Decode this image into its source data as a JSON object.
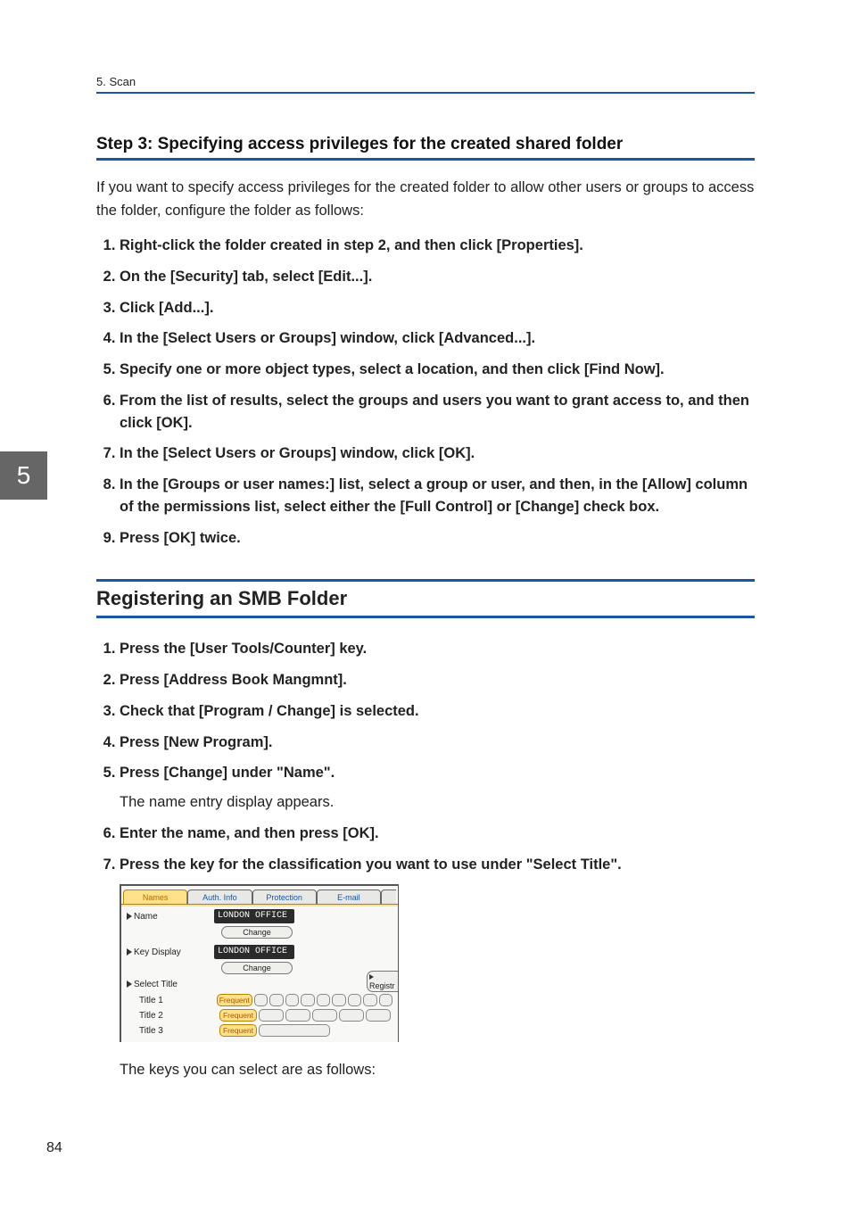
{
  "header": {
    "text": "5. Scan"
  },
  "chapter_tab": "5",
  "page_number": "84",
  "step3": {
    "heading": "Step 3: Specifying access privileges for the created shared folder",
    "intro": "If you want to specify access privileges for the created folder to allow other users or groups to access the folder, configure the folder as follows:",
    "items": [
      "Right-click the folder created in step 2, and then click [Properties].",
      "On the [Security] tab, select [Edit...].",
      "Click [Add...].",
      "In the [Select Users or Groups] window, click [Advanced...].",
      "Specify one or more object types, select a location, and then click [Find Now].",
      "From the list of results, select the groups and users you want to grant access to, and then click [OK].",
      "In the [Select Users or Groups] window, click [OK].",
      "In the [Groups or user names:] list, select a group or user, and then, in the [Allow] column of the permissions list, select either the [Full Control] or [Change] check box.",
      "Press [OK] twice."
    ]
  },
  "register": {
    "heading": "Registering an SMB Folder",
    "items": [
      {
        "main": "Press the [User Tools/Counter] key."
      },
      {
        "main": "Press [Address Book Mangmnt]."
      },
      {
        "main": "Check that [Program / Change] is selected."
      },
      {
        "main": "Press [New Program]."
      },
      {
        "main": "Press [Change] under \"Name\".",
        "sub": "The name entry display appears."
      },
      {
        "main": "Enter the name, and then press [OK]."
      },
      {
        "main": "Press the key for the classification you want to use under \"Select Title\"."
      }
    ],
    "after_image": "The keys you can select are as follows:"
  },
  "ui": {
    "tabs": {
      "names": "Names",
      "auth": "Auth. Info",
      "protection": "Protection",
      "email": "E-mail"
    },
    "labels": {
      "name": "Name",
      "key_display": "Key Display",
      "select_title": "Select Title",
      "title1": "Title 1",
      "title2": "Title 2",
      "title3": "Title 3"
    },
    "values": {
      "name": "LONDON OFFICE",
      "key_display": "LONDON OFFICE"
    },
    "buttons": {
      "change": "Change",
      "regist": "Registr",
      "frequent": "Frequent"
    }
  }
}
